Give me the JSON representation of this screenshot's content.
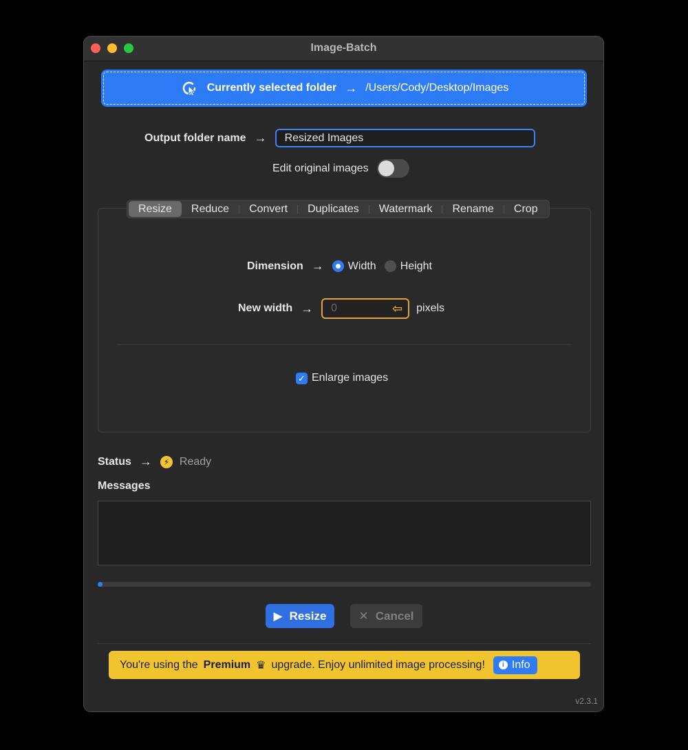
{
  "window": {
    "title": "Image-Batch"
  },
  "folder": {
    "label": "Currently selected folder",
    "path": "/Users/Cody/Desktop/Images",
    "icon": "folder-select-icon"
  },
  "output": {
    "label": "Output folder name",
    "value": "Resized Images"
  },
  "edit_original": {
    "label": "Edit original images",
    "enabled": false
  },
  "tabs": [
    {
      "label": "Resize",
      "active": true
    },
    {
      "label": "Reduce",
      "active": false
    },
    {
      "label": "Convert",
      "active": false
    },
    {
      "label": "Duplicates",
      "active": false
    },
    {
      "label": "Watermark",
      "active": false
    },
    {
      "label": "Rename",
      "active": false
    },
    {
      "label": "Crop",
      "active": false
    }
  ],
  "resize": {
    "dimension_label": "Dimension",
    "options": [
      {
        "label": "Width",
        "selected": true
      },
      {
        "label": "Height",
        "selected": false
      }
    ],
    "new_width_label": "New width",
    "new_width_placeholder": "0",
    "unit": "pixels",
    "enlarge_label": "Enlarge images",
    "enlarge_checked": true
  },
  "status": {
    "label": "Status",
    "value": "Ready"
  },
  "messages": {
    "label": "Messages"
  },
  "progress": {
    "fraction": 0.0
  },
  "buttons": {
    "primary": "Resize",
    "cancel": "Cancel"
  },
  "premium": {
    "before": "You're using the",
    "plan": "Premium",
    "after": "upgrade. Enjoy unlimited image processing!",
    "info": "Info"
  },
  "version": "v2.3.1",
  "colors": {
    "accent": "#2f7bf5",
    "premium": "#efc42f",
    "warning": "#e5a03a"
  }
}
